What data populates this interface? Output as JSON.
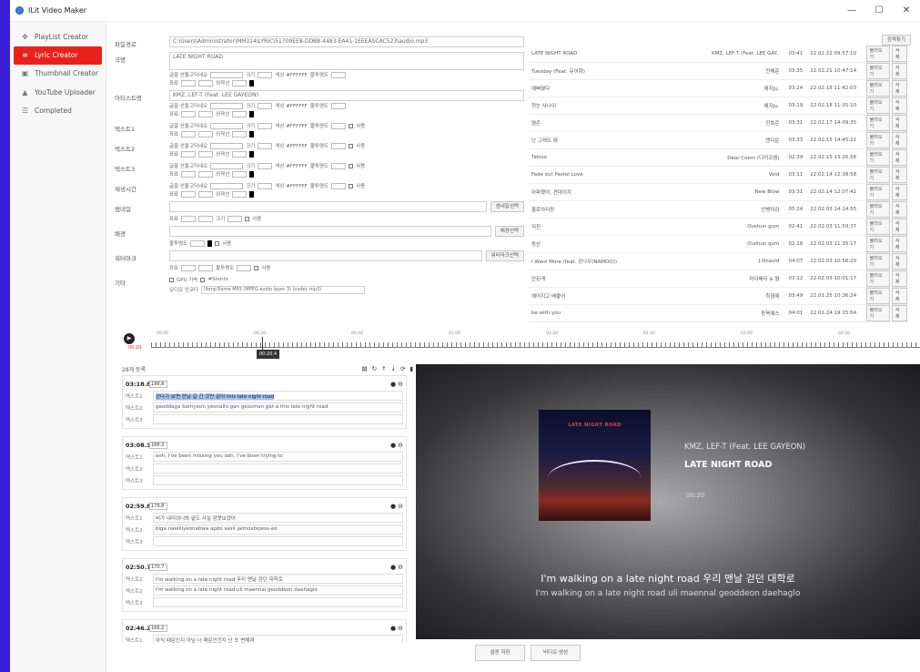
{
  "window": {
    "title": "ILit Video Maker",
    "minimize": "—",
    "maximize": "☐",
    "close": "✕"
  },
  "sidebar": {
    "items": [
      {
        "label": "PlayList Creator",
        "icon": "playlist-icon"
      },
      {
        "label": "Lyric Creator",
        "icon": "lyric-icon",
        "active": true
      },
      {
        "label": "Thumbnail Creator",
        "icon": "image-icon"
      },
      {
        "label": "YouTube Uploader",
        "icon": "upload-icon"
      },
      {
        "label": "Completed",
        "icon": "list-icon"
      }
    ]
  },
  "form": {
    "file_label": "파일경로",
    "file_path": "C:\\Users\\Administrator\\MM314\\LYRIC\\51709EE8-DDB8-4483-EA41-1EEEASCAC523\\audio.mp3",
    "song_label": "곡명",
    "song_value": "LATE NIGHT ROAD",
    "artist_label": "아티스트명",
    "artist_value": "KMZ, LEF-T (Feat. LEE GAYEON)",
    "text1_label": "텍스트1",
    "text2_label": "텍스트2",
    "text3_label": "텍스트3",
    "playtime_label": "재생시간",
    "thumb_label": "썸네일",
    "thumb_btn": "썸네일선택",
    "bg_label": "배경",
    "bg_btn": "배경선택",
    "wm_label": "워터마크",
    "wm_btn": "워터마크선택",
    "etc_label": "기타",
    "font_opt": "글꼴 산돌고딕네오",
    "size_opt": "크기",
    "color_opt": "색상 #FFFFFF",
    "opacity_opt": "불투명도",
    "pos_opt": "좌표",
    "shadow_opt": "외곽선",
    "use_opt": "사용",
    "etc_gpu": "GPU 가속",
    "etc_shorts": "#Shorts",
    "audio_enc_label": "오디오 인코더",
    "audio_enc_value": "libmp3lame MP3 (MPEG audio layer 3) (codec mp3)"
  },
  "playlist": {
    "search_btn": "검색찾기",
    "load_btn": "불러오기",
    "del_btn": "삭제",
    "rows": [
      {
        "title": "LATE NIGHT ROAD",
        "artist": "KMZ, LEF-T (Feat. LEE GAY..",
        "dur": "03:41",
        "date": "22.02.22 09:57:10"
      },
      {
        "title": "Tuesday (Feat. 유이화)",
        "artist": "전해준",
        "dur": "03:35",
        "date": "22.02.21 10:47:14"
      },
      {
        "title": "예뻐졌다",
        "artist": "헤지Ju.",
        "dur": "03:24",
        "date": "22.02.18 11:42:03"
      },
      {
        "title": "첫눈 사나이",
        "artist": "헤지Ju.",
        "dur": "03:19",
        "date": "22.02.18 11:35:10"
      },
      {
        "title": "염존",
        "artist": "전호준",
        "dur": "03:31",
        "date": "22.02.17 14:09:35"
      },
      {
        "title": "난 그래도 돼",
        "artist": "엔다운",
        "dur": "03:33",
        "date": "22.02.15 14:45:21"
      },
      {
        "title": "Tattoo",
        "artist": "Dear Coem (디어코엠)",
        "dur": "02:39",
        "date": "22.02.15 13:26:56"
      },
      {
        "title": "Fade out Pastel Love",
        "artist": "Void",
        "dur": "03:11",
        "date": "22.02.14 12:38:58"
      },
      {
        "title": "아파했어, 견대이지",
        "artist": "New Blow",
        "dur": "03:31",
        "date": "22.02.14 12:07:42"
      },
      {
        "title": "홀로아리랑",
        "artist": "안뱅마강",
        "dur": "05:24",
        "date": "22.02.03 14:14:55"
      },
      {
        "title": "직진",
        "artist": "Oushun gum",
        "dur": "02:41",
        "date": "22.02.03 11:59:37"
      },
      {
        "title": "등산",
        "artist": "Oushun gum",
        "dur": "02:18",
        "date": "22.02.03 11:35:17"
      },
      {
        "title": "I Want More (feat. 강나무(NAMOO))",
        "artist": "J.Onavid",
        "dur": "04:07",
        "date": "22.02.03 10:56:20"
      },
      {
        "title": "안된게",
        "artist": "마이베터 & 형",
        "dur": "03:12",
        "date": "22.02.03 10:01:17"
      },
      {
        "title": "헤어지고 배불어",
        "artist": "최형제",
        "dur": "03:49",
        "date": "22.01.25 10:36:24"
      },
      {
        "title": "be with you",
        "artist": "동욱예스",
        "dur": "04:01",
        "date": "22.01.24 19:15:54"
      }
    ]
  },
  "timeline": {
    "play": "▶",
    "current": "00:20",
    "bubble": "00:20.4",
    "ticks": [
      "00:00",
      "00:20",
      "00:40",
      "01:00",
      "01:20",
      "01:40",
      "02:00",
      "02:20"
    ]
  },
  "lyrics": {
    "count": "28개 등록",
    "label1": "텍스트1",
    "label2": "텍스트2",
    "label3": "텍스트3",
    "cards": [
      {
        "time": "03:18.8",
        "spin": "198.8",
        "t1": "걷다가 보면 맨날 갈 간 것만 같아 this late night road",
        "t2": "geoddaga bomyeon yeonallo gan geosman gat-a this late night road",
        "t3": ""
      },
      {
        "time": "03:08.3",
        "spin": "188.3",
        "t1": "ooh, I've been missing you ooh, I've been trying to",
        "t2": "",
        "t3": ""
      },
      {
        "time": "02:59.8",
        "spin": "179.8",
        "t1": "비가 내리려니봐 얕도 사실 잠못보겠어",
        "t2": "biga naeliliyeonabwa apdo sasil jalmosbojess-eo",
        "t3": ""
      },
      {
        "time": "02:50.7",
        "spin": "170.7",
        "t1": "I'm walking on a late night road 우리 맨날 걷던 대학로",
        "t2": "I'm walking on a late night road uli maennal geoddeon daehaglo",
        "t3": ""
      },
      {
        "time": "02:46.2",
        "spin": "166.2",
        "t1": "아직 때문인지 아님 너 때문인건지 난 또 변해져",
        "t2": "",
        "t3": ""
      }
    ]
  },
  "preview": {
    "art_title": "LATE NIGHT ROAD",
    "artist": "KMZ, LEF-T (Feat. LEE GAYEON)",
    "song": "LATE NIGHT ROAD",
    "time": "00:20",
    "lyric1": "I'm walking on a late night road 우리 맨날 걷던 대학로",
    "lyric2": "I'm walking on a late night road uli maennal geoddeon daehaglo"
  },
  "buttons": {
    "save": "설정 저장",
    "make": "비디오 생성"
  }
}
